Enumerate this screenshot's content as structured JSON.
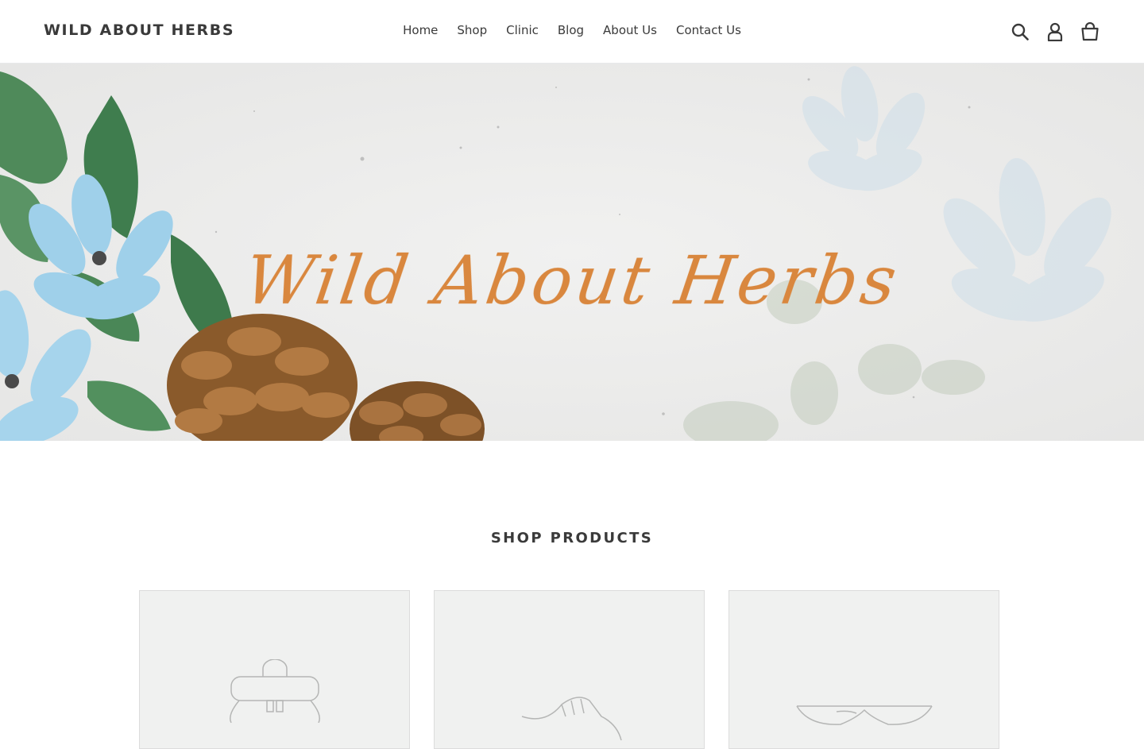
{
  "header": {
    "logo": "WILD ABOUT HERBS",
    "nav": [
      {
        "label": "Home"
      },
      {
        "label": "Shop"
      },
      {
        "label": "Clinic"
      },
      {
        "label": "Blog"
      },
      {
        "label": "About Us"
      },
      {
        "label": "Contact Us"
      }
    ],
    "icons": [
      "search-icon",
      "account-icon",
      "cart-icon"
    ]
  },
  "hero": {
    "title": "Wild About Herbs",
    "title_color": "#d9873e"
  },
  "products": {
    "heading": "SHOP PRODUCTS",
    "cards": [
      {
        "icon": "backpack-placeholder-icon"
      },
      {
        "icon": "shoe-placeholder-icon"
      },
      {
        "icon": "sunglasses-placeholder-icon"
      }
    ]
  }
}
